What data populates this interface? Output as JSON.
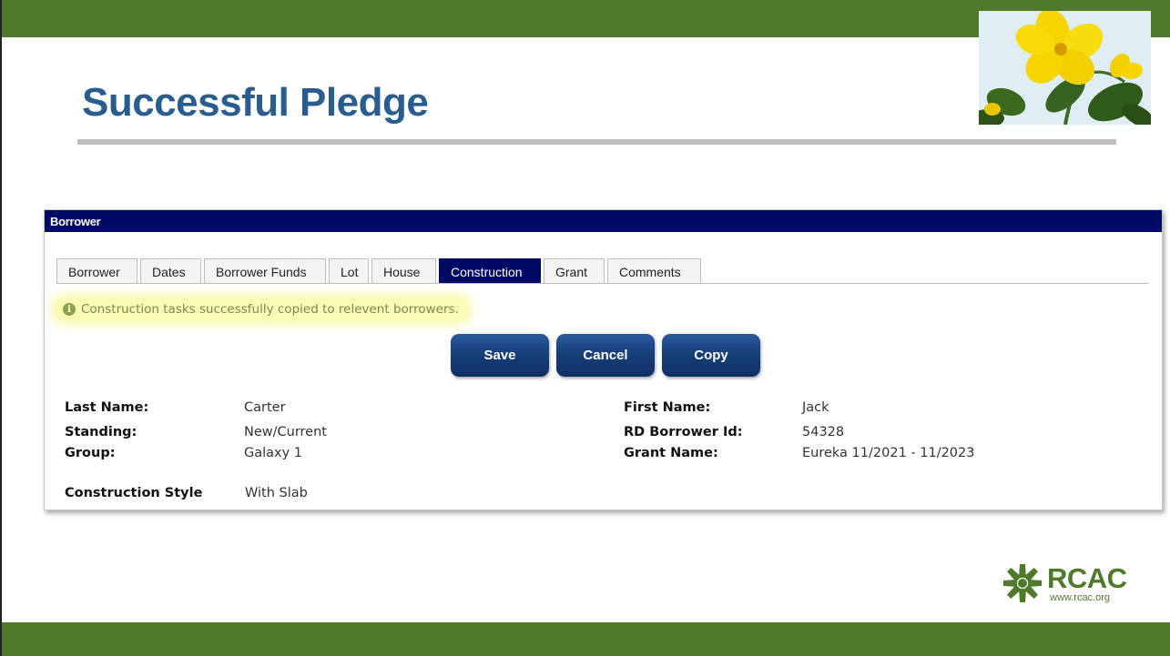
{
  "slide": {
    "title": "Successful Pledge"
  },
  "panel": {
    "header": "Borrower",
    "tabs": [
      {
        "label": "Borrower",
        "active": false
      },
      {
        "label": "Dates",
        "active": false
      },
      {
        "label": "Borrower Funds",
        "active": false
      },
      {
        "label": "Lot",
        "active": false
      },
      {
        "label": "House",
        "active": false
      },
      {
        "label": "Construction",
        "active": true
      },
      {
        "label": "Grant",
        "active": false
      },
      {
        "label": "Comments",
        "active": false
      }
    ],
    "message": "Construction tasks successfully copied to relevent borrowers.",
    "buttons": {
      "save": "Save",
      "cancel": "Cancel",
      "copy": "Copy"
    },
    "fields": {
      "last_name_label": "Last Name:",
      "last_name_value": "Carter",
      "standing_label": "Standing:",
      "standing_value": "New/Current",
      "group_label": "Group:",
      "group_value": "Galaxy 1",
      "first_name_label": "First Name:",
      "first_name_value": "Jack",
      "rd_borrower_id_label": "RD Borrower Id:",
      "rd_borrower_id_value": "54328",
      "grant_name_label": "Grant Name:",
      "grant_name_value": "Eureka 11/2021 - 11/2023",
      "construction_style_label": "Construction Style",
      "construction_style_value": "With Slab"
    }
  },
  "logo": {
    "name": "RCAC",
    "url": "www.rcac.org"
  },
  "colors": {
    "band_green": "#4f7a2b",
    "title_blue": "#2a5d8f",
    "header_navy": "#000a66",
    "highlight_yellow": "#f5f778"
  }
}
